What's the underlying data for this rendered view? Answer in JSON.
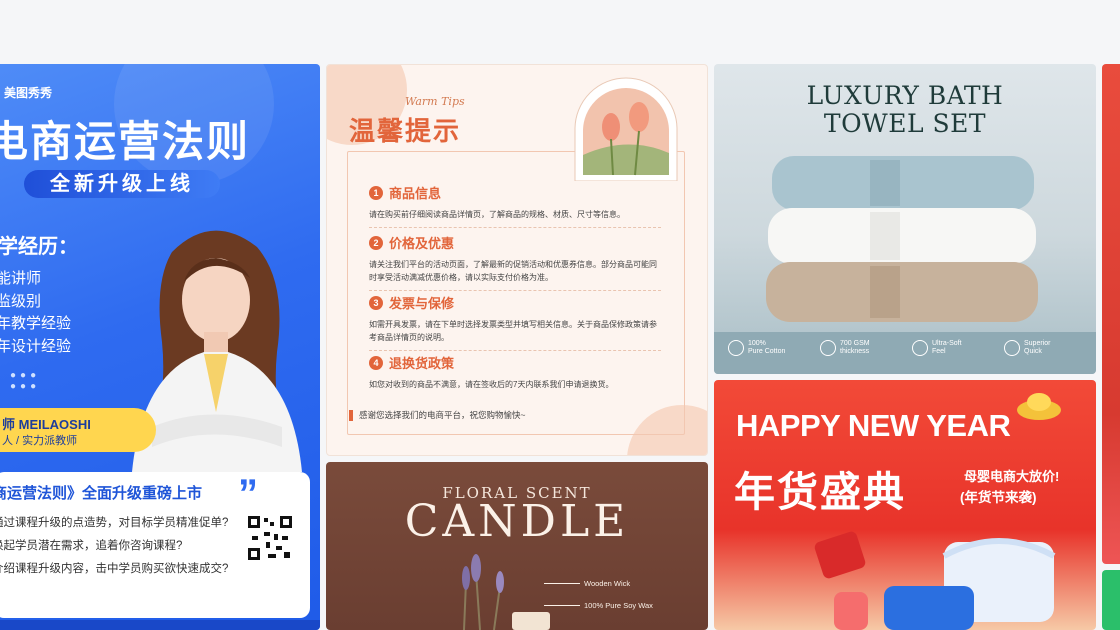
{
  "course_card": {
    "brand": "美图秀秀",
    "title": "电商运营法则",
    "subtitle": "全新升级上线",
    "experience_title": "学经历：",
    "experience_items": [
      "能讲师",
      "监级别",
      "年教学经验",
      "年设计经验"
    ],
    "teacher_name": "师  MEILAOSHI",
    "teacher_tag": "人 / 实力派教师",
    "panel_heading": "商运营法则》全面升级重磅上市",
    "panel_lines": [
      "通过课程升级的点造势，对目标学员精准促单?",
      "唤起学员潜在需求，追着你咨询课程?",
      "介绍课程升级内容，击中学员购买欲快速成交?"
    ],
    "colors": {
      "accent": "#2f6bf0",
      "name_bar": "#ffd64f"
    }
  },
  "tips_card": {
    "script": "Warm  Tips",
    "title": "温馨提示",
    "sections": [
      {
        "num": "1",
        "heading": "商品信息",
        "text": "请在购买前仔细阅读商品详情页，了解商品的规格、材质、尺寸等信息。"
      },
      {
        "num": "2",
        "heading": "价格及优惠",
        "text": "请关注我们平台的活动页面，了解最新的促销活动和优惠券信息。部分商品可能同时享受活动满减优惠价格，请以实际支付价格为准。"
      },
      {
        "num": "3",
        "heading": "发票与保修",
        "text": "如需开具发票，请在下单时选择发票类型并填写相关信息。关于商品保修政策请参考商品详情页的说明。"
      },
      {
        "num": "4",
        "heading": "退换货政策",
        "text": "如您对收到的商品不满意，请在签收后的7天内联系我们申请退换货。"
      }
    ],
    "footer": "感谢您选择我们的电商平台，祝您购物愉快~",
    "colors": {
      "accent": "#e2653b"
    }
  },
  "towel_card": {
    "title_line1": "LUXURY BATH",
    "title_line2": "TOWEL SET",
    "features": [
      {
        "icon": "leaf-icon",
        "line1": "100%",
        "line2": "Pure Cotton"
      },
      {
        "icon": "layers-icon",
        "line1": "700 GSM",
        "line2": "thickness"
      },
      {
        "icon": "feather-icon",
        "line1": "Ultra-Soft",
        "line2": "Feel"
      },
      {
        "icon": "drop-icon",
        "line1": "Superior",
        "line2": "Quick"
      }
    ]
  },
  "candle_card": {
    "subtitle": "FLORAL SCENT",
    "title": "CANDLE",
    "labels": [
      "Wooden Wick",
      "100% Pure Soy Wax"
    ]
  },
  "newyear_card": {
    "title": "HAPPY NEW YEAR",
    "subtitle": "年货盛典",
    "promo_line1": "母婴电商大放价!",
    "promo_line2": "(年货节来袭)"
  }
}
